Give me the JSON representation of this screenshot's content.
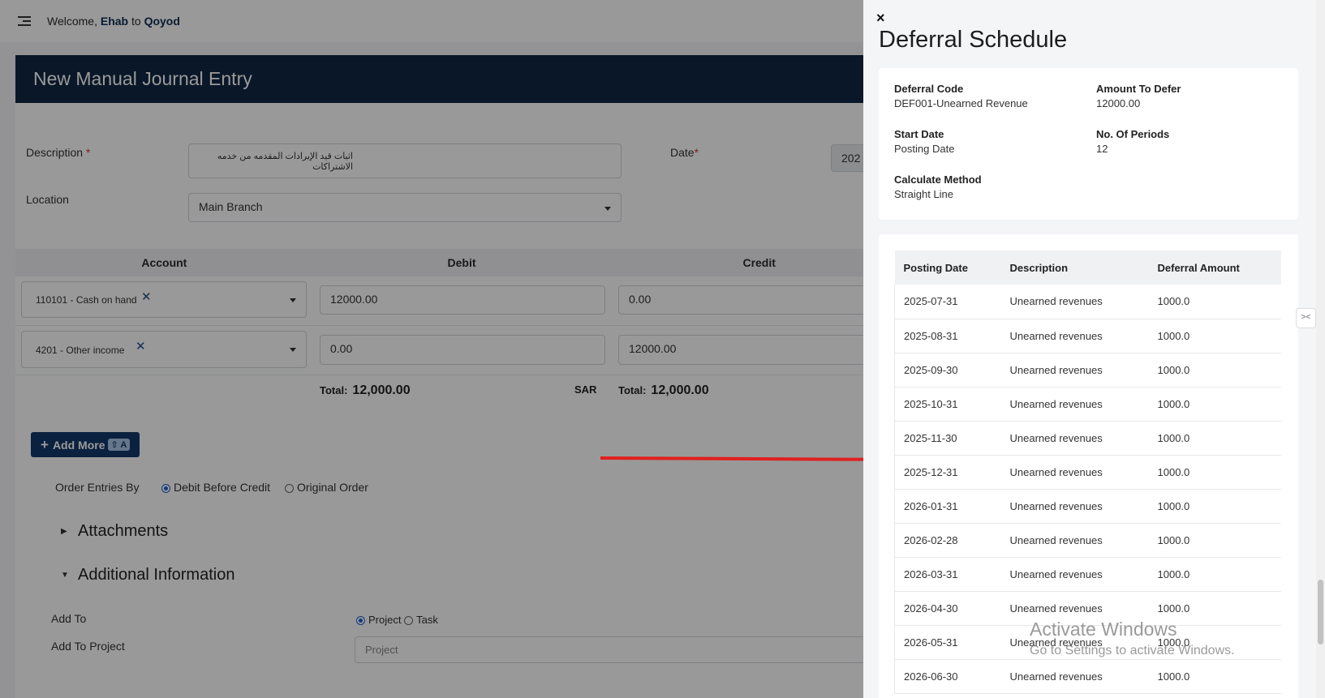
{
  "topbar": {
    "welcome": "Welcome,",
    "user": "Ehab",
    "to": "to",
    "company": "Qoyod"
  },
  "journal": {
    "title": "New Manual Journal Entry",
    "description_label": "Description",
    "description_value": "اثبات قيد الإيرادات المقدمه من خدمه الاشتراكات",
    "date_label": "Date",
    "date_value": "202",
    "location_label": "Location",
    "location_value": "Main Branch",
    "columns": [
      "Account",
      "Debit",
      "Credit"
    ],
    "lines": [
      {
        "account": "110101 - Cash on hand",
        "debit": "12000.00",
        "credit": "0.00"
      },
      {
        "account": "4201 - Other income",
        "debit": "0.00",
        "credit": "12000.00"
      }
    ],
    "total_label": "Total:",
    "total_debit": "12,000.00",
    "currency": "SAR",
    "total_credit": "12,000.00",
    "add_more": "Add More",
    "add_more_kbd": "⇧ A",
    "order_label": "Order Entries By",
    "order_opt1": "Debit Before Credit",
    "order_opt2": "Original Order",
    "attachments": "Attachments",
    "additional_info": "Additional Information",
    "add_to_label": "Add To",
    "add_to_opt1": "Project",
    "add_to_opt2": "Task",
    "add_to_project_label": "Add To Project",
    "project_placeholder": "Project"
  },
  "panel": {
    "close": "×",
    "title": "Deferral Schedule",
    "info": {
      "deferral_code_k": "Deferral Code",
      "deferral_code_v": "DEF001-Unearned Revenue",
      "amount_k": "Amount To Defer",
      "amount_v": "12000.00",
      "start_k": "Start Date",
      "start_v": "Posting Date",
      "periods_k": "No. Of Periods",
      "periods_v": "12",
      "method_k": "Calculate Method",
      "method_v": "Straight Line"
    },
    "columns": [
      "Posting Date",
      "Description",
      "Deferral Amount"
    ],
    "rows": [
      [
        "2025-07-31",
        "Unearned revenues",
        "1000.0"
      ],
      [
        "2025-08-31",
        "Unearned revenues",
        "1000.0"
      ],
      [
        "2025-09-30",
        "Unearned revenues",
        "1000.0"
      ],
      [
        "2025-10-31",
        "Unearned revenues",
        "1000.0"
      ],
      [
        "2025-11-30",
        "Unearned revenues",
        "1000.0"
      ],
      [
        "2025-12-31",
        "Unearned revenues",
        "1000.0"
      ],
      [
        "2026-01-31",
        "Unearned revenues",
        "1000.0"
      ],
      [
        "2026-02-28",
        "Unearned revenues",
        "1000.0"
      ],
      [
        "2026-03-31",
        "Unearned revenues",
        "1000.0"
      ],
      [
        "2026-04-30",
        "Unearned revenues",
        "1000.0"
      ],
      [
        "2026-05-31",
        "Unearned revenues",
        "1000.0"
      ],
      [
        "2026-06-30",
        "Unearned revenues",
        "1000.0"
      ]
    ]
  },
  "watermark": {
    "line1": "Activate Windows",
    "line2": "Go to Settings to activate Windows."
  },
  "colors": {
    "header": "#0f2743",
    "accent": "#13376b",
    "arrow": "#e0201f"
  }
}
